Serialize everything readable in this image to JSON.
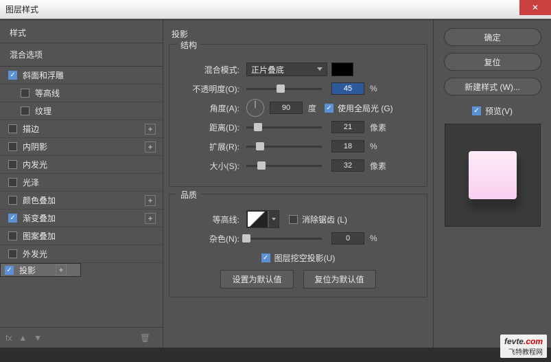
{
  "title": "图层样式",
  "sidebar": {
    "head": "样式",
    "section": "混合选项",
    "items": [
      {
        "label": "斜面和浮雕",
        "checked": true,
        "add": false,
        "sub": false
      },
      {
        "label": "等高线",
        "checked": false,
        "add": false,
        "sub": true
      },
      {
        "label": "纹理",
        "checked": false,
        "add": false,
        "sub": true
      },
      {
        "label": "描边",
        "checked": false,
        "add": true,
        "sub": false
      },
      {
        "label": "内阴影",
        "checked": false,
        "add": true,
        "sub": false
      },
      {
        "label": "内发光",
        "checked": false,
        "add": false,
        "sub": false
      },
      {
        "label": "光泽",
        "checked": false,
        "add": false,
        "sub": false
      },
      {
        "label": "颜色叠加",
        "checked": false,
        "add": true,
        "sub": false
      },
      {
        "label": "渐变叠加",
        "checked": true,
        "add": true,
        "sub": false
      },
      {
        "label": "图案叠加",
        "checked": false,
        "add": false,
        "sub": false
      },
      {
        "label": "外发光",
        "checked": false,
        "add": false,
        "sub": false
      },
      {
        "label": "投影",
        "checked": true,
        "add": true,
        "sub": false,
        "selected": true
      }
    ]
  },
  "panel": {
    "title": "投影",
    "structure": {
      "legend": "结构",
      "blend": {
        "label": "混合模式:",
        "value": "正片叠底"
      },
      "opacity": {
        "label": "不透明度(O):",
        "value": "45",
        "unit": "%",
        "pos": 45
      },
      "angle": {
        "label": "角度(A):",
        "value": "90",
        "degree": "度",
        "global_label": "使用全局光 (G)",
        "global": true
      },
      "distance": {
        "label": "距离(D):",
        "value": "21",
        "unit": "像素",
        "pos": 15
      },
      "spread": {
        "label": "扩展(R):",
        "value": "18",
        "unit": "%",
        "pos": 18
      },
      "size": {
        "label": "大小(S):",
        "value": "32",
        "unit": "像素",
        "pos": 20
      }
    },
    "quality": {
      "legend": "品质",
      "contour": {
        "label": "等高线:",
        "anti_label": "消除锯齿 (L)",
        "anti": false
      },
      "noise": {
        "label": "杂色(N):",
        "value": "0",
        "unit": "%",
        "pos": 0
      }
    },
    "knockout": {
      "label": "图层挖空投影(U)",
      "checked": true
    },
    "buttons": {
      "default": "设置为默认值",
      "reset": "复位为默认值"
    }
  },
  "right": {
    "ok": "确定",
    "cancel": "复位",
    "new": "新建样式 (W)...",
    "preview_label": "预览(V)",
    "preview_checked": true
  },
  "watermark": {
    "main": "fevte",
    "dot": ".com",
    "sub": "飞特教程网"
  }
}
